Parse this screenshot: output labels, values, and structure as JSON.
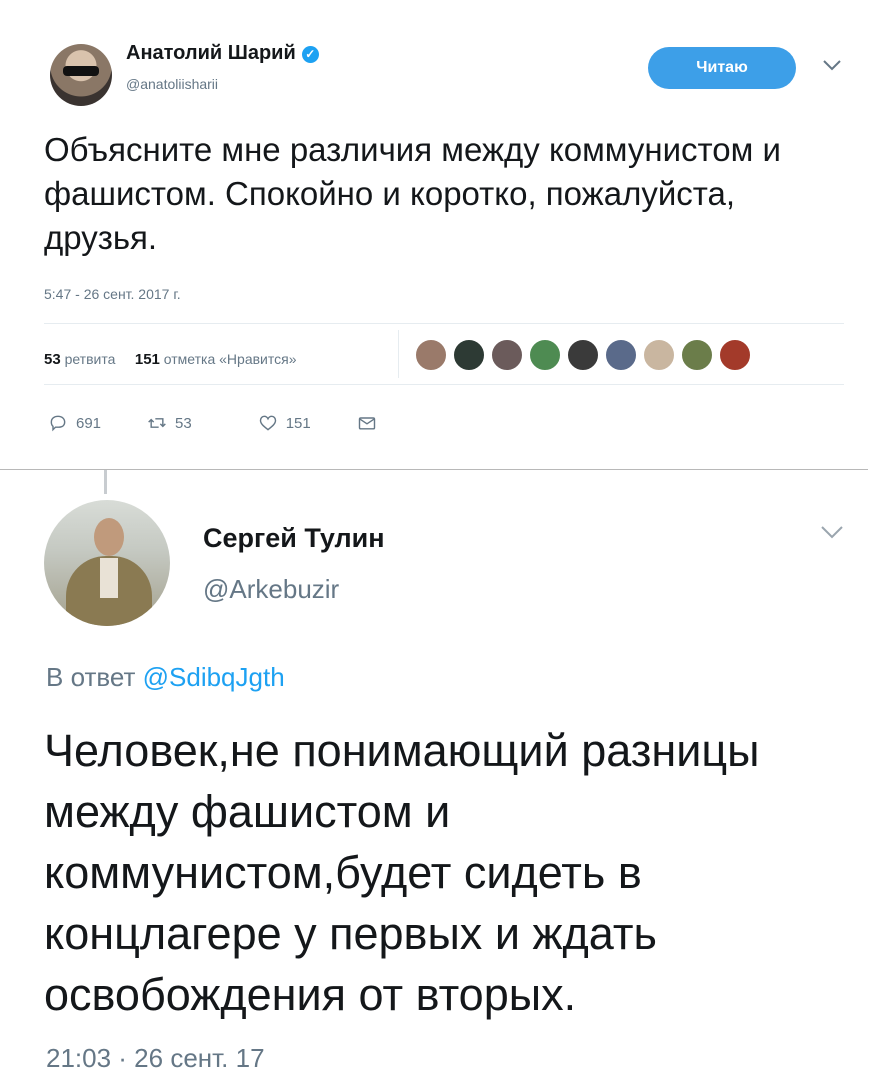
{
  "tweet1": {
    "author_name": "Анатолий Шарий",
    "verified_mark": "✓",
    "handle": "@anatoliisharii",
    "follow_label": "Читаю",
    "menu_icon": "chevron-down-icon",
    "text": "Объясните мне различия между коммунистом и фашистом. Спокойно и коротко, пожалуйста, друзья.",
    "timestamp": "5:47 - 26 сент. 2017 г.",
    "retweets_count": "53",
    "retweets_label": "ретвита",
    "likes_count": "151",
    "likes_label": "отметка «Нравится»",
    "liker_colors": [
      "#9a7a6a",
      "#2d3a34",
      "#6b5b5b",
      "#4e8b52",
      "#3a3a3a",
      "#5a6a8a",
      "#c9b6a0",
      "#6b7d4a",
      "#a33a2a"
    ],
    "actions": {
      "replies": "691",
      "retweets": "53",
      "likes": "151"
    }
  },
  "tweet2": {
    "author_name": "Сергей Тулин",
    "handle": "@Arkebuzir",
    "menu_icon": "chevron-down-icon",
    "reply_prefix": "В ответ",
    "reply_handle": "@SdibqJgth",
    "text": "Человек,не понимающий разницы между фашистом и коммунистом,будет сидеть в концлагере у первых и ждать освобождения от вторых.",
    "timestamp": "21:03 · 26 сент. 17"
  },
  "colors": {
    "accent": "#1da1f2",
    "follow_button": "#3d9fe8",
    "muted": "#657786"
  }
}
